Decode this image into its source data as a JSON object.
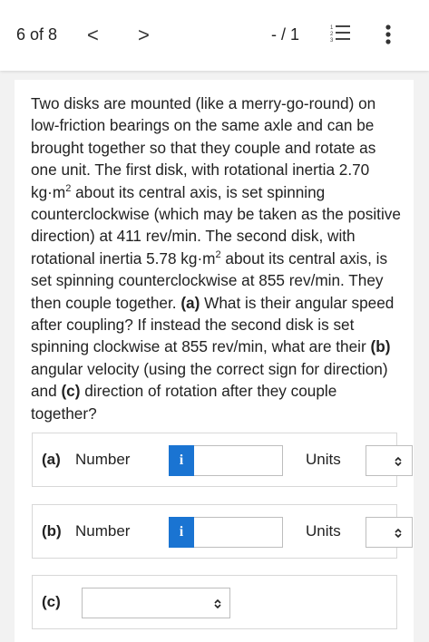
{
  "nav": {
    "counter": "6 of 8",
    "prev_glyph": "<",
    "next_glyph": ">",
    "score": "- / 1",
    "list_icon": "question-list-icon",
    "more_icon": "more-vertical-icon"
  },
  "question": {
    "t1": "Two disks are mounted (like a merry-go-round) on low-friction bearings on the same axle and can be brought together so that they couple and rotate as one unit. The first disk, with rotational inertia 2.70 kg·m",
    "sup1": "2",
    "t2": " about its central axis, is set spinning counterclockwise (which may be taken as the positive direction) at 411 rev/min. The second disk, with rotational inertia 5.78 kg·m",
    "sup2": "2",
    "t3": " about its central axis, is set spinning counterclockwise at 855 rev/min. They then couple together. ",
    "pa": "(a)",
    "t4": " What is their angular speed after coupling? If instead the second disk is set spinning clockwise at 855 rev/min, what are their ",
    "pb": "(b)",
    "t5": " angular velocity (using the correct sign for direction) and ",
    "pc": "(c)",
    "t6": " direction of rotation after they couple together?"
  },
  "answers": {
    "a": {
      "part": "(a)",
      "number_label": "Number",
      "info_glyph": "i",
      "value": "",
      "units_label": "Units",
      "units_value": ""
    },
    "b": {
      "part": "(b)",
      "number_label": "Number",
      "info_glyph": "i",
      "value": "",
      "units_label": "Units",
      "units_value": ""
    },
    "c": {
      "part": "(c)",
      "value": ""
    }
  },
  "colors": {
    "accent": "#1a74d2",
    "background": "#f2f2f2"
  }
}
